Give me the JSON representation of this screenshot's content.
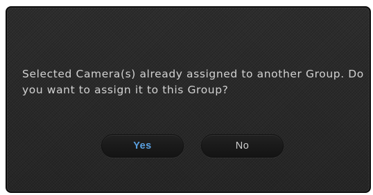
{
  "dialog": {
    "message": "Selected Camera(s) already assigned to another Group. Do you want to assign it to this Group?",
    "yes_label": "Yes",
    "no_label": "No"
  },
  "colors": {
    "background": "#2a2a2a",
    "message_text": "#d2d2d2",
    "yes_text": "#5aa0e0",
    "no_text": "#d0d0d0"
  }
}
